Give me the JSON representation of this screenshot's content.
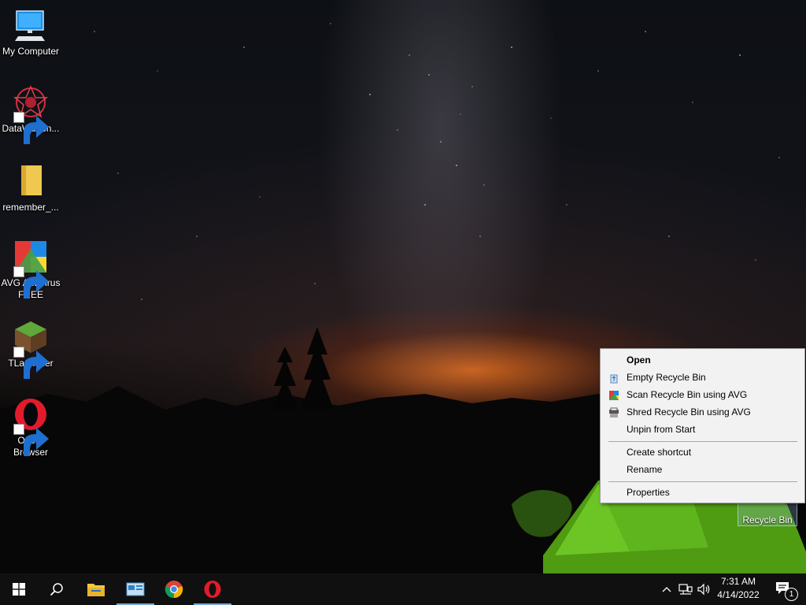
{
  "desktop": {
    "icons": [
      {
        "label": "My Computer"
      },
      {
        "label": "DataWagon..."
      },
      {
        "label": "remember_..."
      },
      {
        "label": "AVG AntiVirus FREE"
      },
      {
        "label": "TLauncher"
      },
      {
        "label": "Opera Browser"
      }
    ],
    "recycle_bin_label": "Recycle Bin"
  },
  "context_menu": {
    "items": [
      {
        "label": "Open",
        "bold": true,
        "icon": "none"
      },
      {
        "label": "Empty Recycle Bin",
        "icon": "recycle-icon"
      },
      {
        "label": "Scan Recycle Bin using AVG",
        "icon": "avg-icon"
      },
      {
        "label": "Shred Recycle Bin using AVG",
        "icon": "shredder-icon"
      },
      {
        "label": "Unpin from Start",
        "icon": "none"
      },
      {
        "label": "Create shortcut",
        "icon": "none"
      },
      {
        "label": "Rename",
        "icon": "none"
      },
      {
        "label": "Properties",
        "icon": "none"
      }
    ]
  },
  "taskbar": {
    "pinned": [
      "start-icon",
      "search-icon",
      "file-explorer-icon",
      "control-panel-icon",
      "chrome-icon",
      "opera-icon"
    ],
    "clock": {
      "time": "7:31 AM",
      "date": "4/14/2022"
    },
    "notification_count": "1"
  },
  "colors": {
    "taskbar_bg": "#101010",
    "menu_bg": "#f2f2f2",
    "active_indicator": "#7aa7d9"
  }
}
